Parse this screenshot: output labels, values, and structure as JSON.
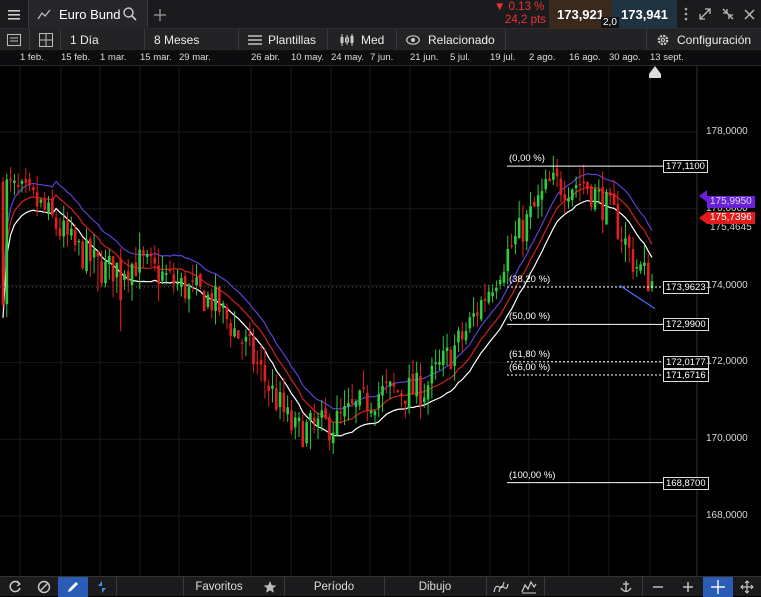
{
  "header": {
    "instrument": "Euro Bund",
    "change_pct": "▼ 0.13 %",
    "change_pts": "24,2 pts",
    "bid": "173,921",
    "ask": "173,941",
    "spread": "2,0"
  },
  "toolbar": {
    "timeframe": "1 Día",
    "range": "8 Meses",
    "templates": "Plantillas",
    "price_type": "Med",
    "related": "Relacionado",
    "settings": "Configuración"
  },
  "timeline_labels": [
    "1 feb.",
    "15 feb.",
    "1 mar.",
    "15 mar.",
    "29 mar.",
    "26 abr.",
    "10 may.",
    "24 may.",
    "7 jun.",
    "21 jun.",
    "5 jul.",
    "19 jul.",
    "2 ago.",
    "16 ago.",
    "30 ago.",
    "13 sept."
  ],
  "price_axis": [
    "178,0000",
    "176,0000",
    "174,0000",
    "172,0000",
    "170,0000",
    "168,0000"
  ],
  "price_tags": {
    "current": "175,7396",
    "hidden_a": "175,4645",
    "hidden_b": "175,9950",
    "last": "173,9623"
  },
  "fibonacci": [
    {
      "pct": "(0,00 %)",
      "value": "177,1100"
    },
    {
      "pct": "(38,20 %)",
      "value": "173,9623"
    },
    {
      "pct": "(50,00 %)",
      "value": "172,9900"
    },
    {
      "pct": "(61,80 %)",
      "value": "172,0177"
    },
    {
      "pct": "(66,00 %)",
      "value": "171,6716"
    },
    {
      "pct": "(100,00 %)",
      "value": "168,8700"
    }
  ],
  "bottom": {
    "favorites": "Favoritos",
    "period": "Período",
    "drawing": "Dibujo"
  },
  "colors": {
    "up": "#2ecc40",
    "down": "#e02020",
    "ma_blue": "#5b3fd6",
    "ma_red": "#d42020",
    "ma_white": "#ffffff",
    "tag_red": "#e31b1b",
    "tag_purple": "#6a1fd8"
  },
  "chart_data": {
    "type": "candlestick",
    "instrument": "Euro Bund",
    "interval": "1 Día",
    "ylim": [
      167.2,
      179.5
    ],
    "y_ticks": [
      168,
      170,
      172,
      174,
      176,
      178
    ],
    "close_path": [
      {
        "date": "1 feb.",
        "close": 176.1
      },
      {
        "date": "15 feb.",
        "close": 175.3
      },
      {
        "date": "1 mar.",
        "close": 174.2
      },
      {
        "date": "15 mar.",
        "close": 174.5
      },
      {
        "date": "29 mar.",
        "close": 173.8
      },
      {
        "date": "26 abr.",
        "close": 172.3
      },
      {
        "date": "10 may.",
        "close": 170.0
      },
      {
        "date": "24 may.",
        "close": 170.4
      },
      {
        "date": "7 jun.",
        "close": 171.2
      },
      {
        "date": "21 jun.",
        "close": 171.3
      },
      {
        "date": "5 jul.",
        "close": 172.6
      },
      {
        "date": "19 jul.",
        "close": 175.2
      },
      {
        "date": "2 ago.",
        "close": 176.8
      },
      {
        "date": "16 ago.",
        "close": 176.9
      },
      {
        "date": "30 ago.",
        "close": 175.2
      },
      {
        "date": "13 sept.",
        "close": 173.9
      }
    ],
    "fib_levels": [
      {
        "pct": 0.0,
        "price": 177.11
      },
      {
        "pct": 38.2,
        "price": 173.9623
      },
      {
        "pct": 50.0,
        "price": 172.99
      },
      {
        "pct": 61.8,
        "price": 172.0177
      },
      {
        "pct": 66.0,
        "price": 171.6716
      },
      {
        "pct": 100.0,
        "price": 168.87
      }
    ],
    "last_price": 173.9623,
    "current_tag": 175.7396
  }
}
